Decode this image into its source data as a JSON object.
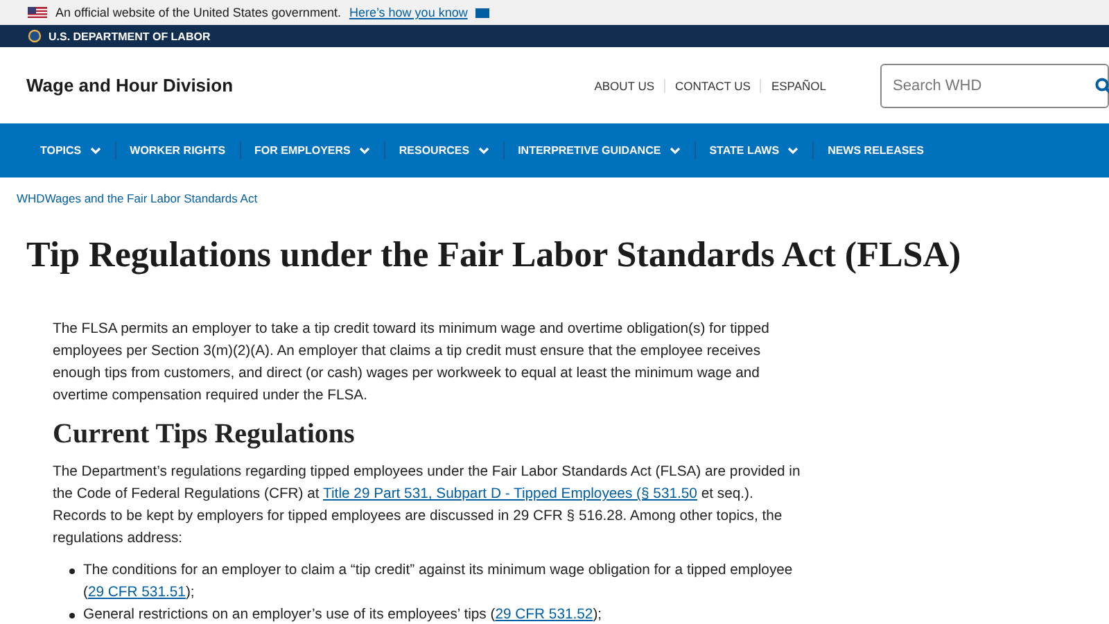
{
  "gov_banner": {
    "text": "An official website of the United States government.",
    "link": "Here’s how you know"
  },
  "agency_bar": {
    "name": "U.S. DEPARTMENT OF LABOR"
  },
  "header": {
    "site_name": "Wage and Hour Division",
    "links": [
      "ABOUT US",
      "CONTACT US",
      "ESPAÑOL"
    ],
    "search": {
      "placeholder": "Search WHD"
    }
  },
  "nav": [
    {
      "label": "TOPICS",
      "dropdown": true
    },
    {
      "label": "WORKER RIGHTS",
      "dropdown": false
    },
    {
      "label": "FOR EMPLOYERS",
      "dropdown": true
    },
    {
      "label": "RESOURCES",
      "dropdown": true
    },
    {
      "label": "INTERPRETIVE GUIDANCE",
      "dropdown": true
    },
    {
      "label": "STATE LAWS",
      "dropdown": true
    },
    {
      "label": "NEWS RELEASES",
      "dropdown": false
    }
  ],
  "breadcrumb": [
    "WHD",
    "Wages and the Fair Labor Standards Act"
  ],
  "title": "Tip Regulations under the Fair Labor Standards Act (FLSA)",
  "content": [
    {
      "kind": "paragraph",
      "parts": [
        {
          "kind": "text",
          "text": "The FLSA permits an employer to take a tip credit toward its minimum wage and overtime obligation(s) for tipped employees per Section 3(m)(2)(A). An employer that claims a tip credit must ensure that the employee receives enough tips from customers, and direct (or cash) wages per workweek to equal at least the minimum wage and overtime compensation required under the FLSA."
        }
      ]
    },
    {
      "kind": "heading",
      "text": "Current Tips Regulations"
    },
    {
      "kind": "paragraph",
      "parts": [
        {
          "kind": "text",
          "text": "The Department’s regulations regarding tipped employees under the Fair Labor Standards Act (FLSA) are provided in the Code of Federal Regulations (CFR) at "
        },
        {
          "kind": "link",
          "text": "Title 29 Part 531, Subpart D - Tipped Employees (§ 531.50"
        },
        {
          "kind": "text",
          "text": " et seq.). Records to be kept by employers for tipped employees are discussed in 29 CFR § 516.28. Among other topics, the regulations address:"
        }
      ]
    },
    {
      "kind": "list",
      "items": [
        {
          "parts": [
            {
              "kind": "text",
              "text": "The conditions for an employer to claim a “tip credit” against its minimum wage obligation for a tipped employee ("
            },
            {
              "kind": "link",
              "text": "29 CFR 531.51"
            },
            {
              "kind": "text",
              "text": ");"
            }
          ]
        },
        {
          "parts": [
            {
              "kind": "text",
              "text": "General restrictions on an employer’s use of its employees’ tips ("
            },
            {
              "kind": "link",
              "text": "29 CFR 531.52"
            },
            {
              "kind": "text",
              "text": ");"
            }
          ]
        }
      ]
    }
  ]
}
